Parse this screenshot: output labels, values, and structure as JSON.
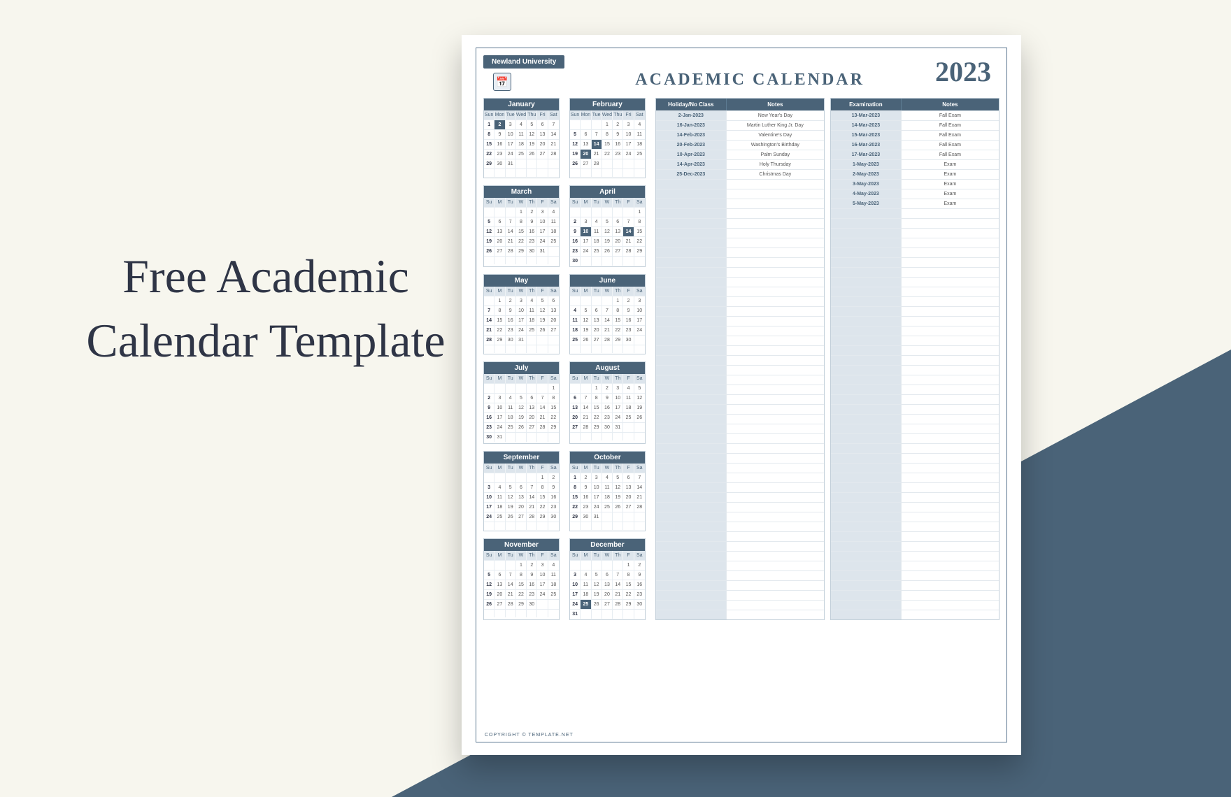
{
  "promo_title": "Free Academic Calendar Template",
  "university": "Newland University",
  "heading": "ACADEMIC CALENDAR",
  "year": "2023",
  "copyright": "COPYRIGHT © TEMPLATE.NET",
  "dow_short": [
    "Su",
    "M",
    "Tu",
    "W",
    "Th",
    "F",
    "Sa"
  ],
  "dow_long": [
    "Sun",
    "Mon",
    "Tue",
    "Wed",
    "Thu",
    "Fri",
    "Sat"
  ],
  "months": [
    {
      "name": "January",
      "start": 0,
      "days": 31,
      "long_dow": true,
      "highlight": [
        2
      ],
      "bold_first_col": true
    },
    {
      "name": "February",
      "start": 3,
      "days": 28,
      "long_dow": true,
      "highlight": [
        14,
        20
      ],
      "bold_first_col": true
    },
    {
      "name": "March",
      "start": 3,
      "days": 31,
      "long_dow": false,
      "highlight": [],
      "bold_first_col": true
    },
    {
      "name": "April",
      "start": 6,
      "days": 30,
      "long_dow": false,
      "highlight": [
        10,
        14
      ],
      "bold_first_col": true
    },
    {
      "name": "May",
      "start": 1,
      "days": 31,
      "long_dow": false,
      "highlight": [],
      "bold_first_col": true
    },
    {
      "name": "June",
      "start": 4,
      "days": 30,
      "long_dow": false,
      "highlight": [],
      "bold_first_col": true
    },
    {
      "name": "July",
      "start": 6,
      "days": 31,
      "long_dow": false,
      "highlight": [],
      "bold_first_col": true
    },
    {
      "name": "August",
      "start": 2,
      "days": 31,
      "long_dow": false,
      "highlight": [],
      "bold_first_col": true
    },
    {
      "name": "September",
      "start": 5,
      "days": 30,
      "long_dow": false,
      "highlight": [],
      "bold_first_col": true
    },
    {
      "name": "October",
      "start": 0,
      "days": 31,
      "long_dow": false,
      "highlight": [],
      "bold_first_col": true
    },
    {
      "name": "November",
      "start": 3,
      "days": 30,
      "long_dow": false,
      "highlight": [],
      "bold_first_col": true
    },
    {
      "name": "December",
      "start": 5,
      "days": 31,
      "long_dow": false,
      "highlight": [
        25
      ],
      "bold_first_col": true
    }
  ],
  "holidays": {
    "h1": "Holiday/No Class",
    "h2": "Notes",
    "rows": [
      {
        "d": "2-Jan-2023",
        "n": "New Year's Day"
      },
      {
        "d": "16-Jan-2023",
        "n": "Martin Luther King Jr. Day"
      },
      {
        "d": "14-Feb-2023",
        "n": "Valentine's Day"
      },
      {
        "d": "20-Feb-2023",
        "n": "Washington's Birthday"
      },
      {
        "d": "10-Apr-2023",
        "n": "Palm Sunday"
      },
      {
        "d": "14-Apr-2023",
        "n": "Holy Thursday"
      },
      {
        "d": "25-Dec-2023",
        "n": "Christmas Day"
      }
    ],
    "blank_rows": 45
  },
  "exams": {
    "h1": "Examination",
    "h2": "Notes",
    "rows": [
      {
        "d": "13-Mar-2023",
        "n": "Fall Exam"
      },
      {
        "d": "14-Mar-2023",
        "n": "Fall Exam"
      },
      {
        "d": "15-Mar-2023",
        "n": "Fall Exam"
      },
      {
        "d": "16-Mar-2023",
        "n": "Fall Exam"
      },
      {
        "d": "17-Mar-2023",
        "n": "Fall Exam"
      },
      {
        "d": "1-May-2023",
        "n": "Exam"
      },
      {
        "d": "2-May-2023",
        "n": "Exam"
      },
      {
        "d": "3-May-2023",
        "n": "Exam"
      },
      {
        "d": "4-May-2023",
        "n": "Exam"
      },
      {
        "d": "5-May-2023",
        "n": "Exam"
      }
    ],
    "blank_rows": 42
  }
}
